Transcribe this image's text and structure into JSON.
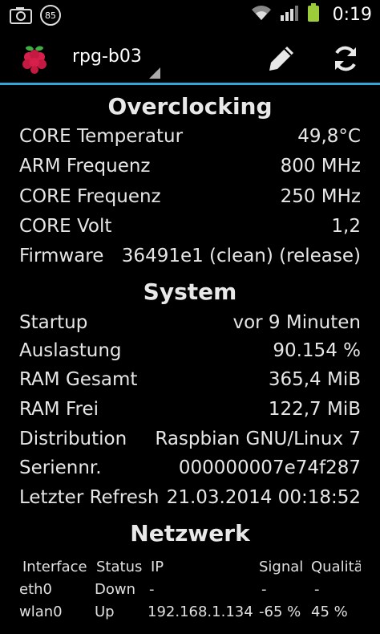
{
  "statusbar": {
    "notification_count": "85",
    "time": "0:19",
    "icons": [
      "screenshot-icon",
      "notification-badge",
      "wifi-icon",
      "signal-icon",
      "battery-icon"
    ]
  },
  "actionbar": {
    "app_icon": "raspberry-icon",
    "title": "rpg-b03",
    "actions": [
      "edit-icon",
      "refresh-icon"
    ],
    "accent_color": "#31a6d8"
  },
  "overclocking": {
    "title": "Overclocking",
    "rows": [
      {
        "label": "CORE Temperatur",
        "value": "49,8°C"
      },
      {
        "label": "ARM Frequenz",
        "value": "800 MHz"
      },
      {
        "label": "CORE Frequenz",
        "value": "250 MHz"
      },
      {
        "label": "CORE Volt",
        "value": "1,2"
      },
      {
        "label": "Firmware",
        "value": "36491e1 (clean) (release)"
      }
    ]
  },
  "system": {
    "title": "System",
    "rows": [
      {
        "label": "Startup",
        "value": "vor 9 Minuten"
      },
      {
        "label": "Auslastung",
        "value": "90.154 %"
      },
      {
        "label": "RAM Gesamt",
        "value": "365,4 MiB"
      },
      {
        "label": "RAM Frei",
        "value": "122,7 MiB"
      },
      {
        "label": "Distribution",
        "value": "Raspbian GNU/Linux 7"
      },
      {
        "label": "Seriennr.",
        "value": "000000007e74f287"
      },
      {
        "label": "Letzter Refresh",
        "value": "21.03.2014 00:18:52"
      }
    ]
  },
  "network": {
    "title": "Netzwerk",
    "headers": [
      "Interface",
      "Status",
      "IP",
      "Signal",
      "Qualität"
    ],
    "rows": [
      [
        "eth0",
        "Down",
        "-",
        "-",
        "-"
      ],
      [
        "wlan0",
        "Up",
        "192.168.1.134",
        "-65 %",
        "45 %"
      ]
    ]
  }
}
